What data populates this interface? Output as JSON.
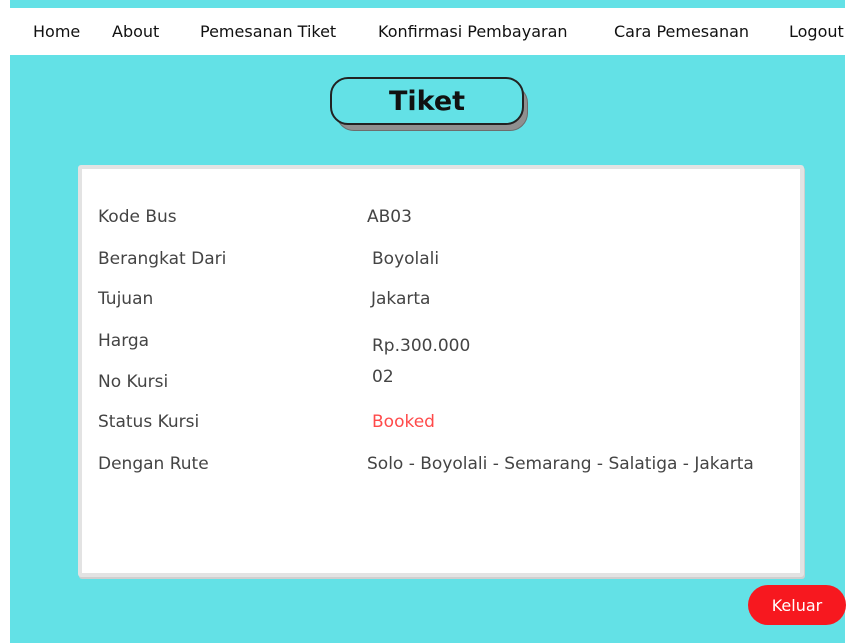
{
  "nav": {
    "home": "Home",
    "about": "About",
    "pemesanan_tiket": "Pemesanan Tiket",
    "konfirmasi_pembayaran": "Konfirmasi Pembayaran",
    "cara_pemesanan": "Cara Pemesanan",
    "logout": "Logout"
  },
  "page_title": "Tiket",
  "ticket": {
    "rows": [
      {
        "label": "Kode Bus",
        "value": "AB03"
      },
      {
        "label": "Berangkat Dari",
        "value": "Boyolali"
      },
      {
        "label": "Tujuan",
        "value": "Jakarta"
      },
      {
        "label": "Harga",
        "value": "Rp.300.000"
      },
      {
        "label": "No Kursi",
        "value": "02"
      },
      {
        "label": "Status Kursi",
        "value": "Booked"
      },
      {
        "label": "Dengan Rute",
        "value": "Solo - Boyolali - Semarang - Salatiga - Jakarta"
      }
    ]
  },
  "actions": {
    "keluar": "Keluar"
  },
  "colors": {
    "background": "#63e1e6",
    "status_booked": "#ff4a4a",
    "keluar_button": "#f7181f"
  }
}
